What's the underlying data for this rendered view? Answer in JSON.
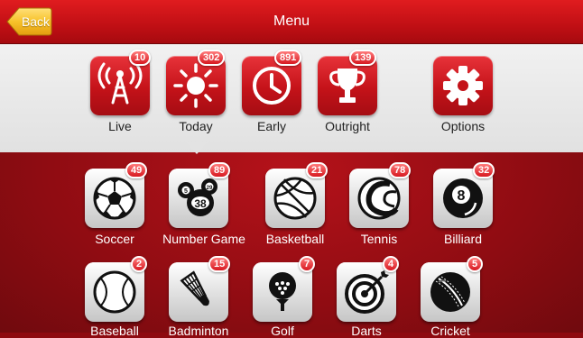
{
  "header": {
    "title": "Menu",
    "back_label": "Back"
  },
  "top_menu": [
    {
      "label": "Live",
      "badge": "10",
      "icon": "live-antenna-icon"
    },
    {
      "label": "Today",
      "badge": "302",
      "icon": "sun-icon"
    },
    {
      "label": "Early",
      "badge": "891",
      "icon": "clock-icon"
    },
    {
      "label": "Outright",
      "badge": "139",
      "icon": "trophy-icon"
    },
    {
      "label": "Options",
      "icon": "gear-icon"
    }
  ],
  "sports": [
    {
      "label": "Soccer",
      "badge": "49",
      "icon": "soccer-ball-icon"
    },
    {
      "label": "Number Game",
      "badge": "89",
      "icon": "number-game-balls-icon",
      "balls": [
        "5",
        "29",
        "38"
      ]
    },
    {
      "label": "Basketball",
      "badge": "21",
      "icon": "basketball-icon"
    },
    {
      "label": "Tennis",
      "badge": "78",
      "icon": "tennis-ball-icon"
    },
    {
      "label": "Billiard",
      "badge": "32",
      "icon": "billiard-ball-icon",
      "ball_number": "8"
    },
    {
      "label": "Baseball",
      "badge": "2",
      "icon": "baseball-icon"
    },
    {
      "label": "Badminton",
      "badge": "15",
      "icon": "shuttlecock-icon"
    },
    {
      "label": "Golf",
      "badge": "7",
      "icon": "golf-ball-icon"
    },
    {
      "label": "Darts",
      "badge": "4",
      "icon": "dartboard-icon"
    },
    {
      "label": "Cricket",
      "badge": "5",
      "icon": "cricket-ball-icon"
    }
  ],
  "colors": {
    "header_red": "#c00f14",
    "tile_red": "#c41219",
    "badge_red": "#d71820",
    "back_button_yellow": "#f2b51b"
  }
}
